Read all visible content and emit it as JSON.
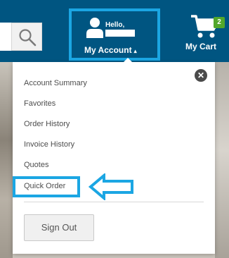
{
  "header": {
    "account": {
      "greeting": "Hello,",
      "label": "My Account",
      "caret": "▴"
    },
    "cart": {
      "label": "My Cart",
      "count": "2"
    }
  },
  "dropdown": {
    "close_glyph": "✕",
    "items": [
      {
        "label": "Account Summary"
      },
      {
        "label": "Favorites"
      },
      {
        "label": "Order History"
      },
      {
        "label": "Invoice History"
      },
      {
        "label": "Quotes"
      },
      {
        "label": "Quick Order"
      }
    ],
    "signout_label": "Sign Out"
  },
  "colors": {
    "header_bg": "#005581",
    "highlight": "#1ba6e3",
    "cart_badge": "#52a72b"
  }
}
